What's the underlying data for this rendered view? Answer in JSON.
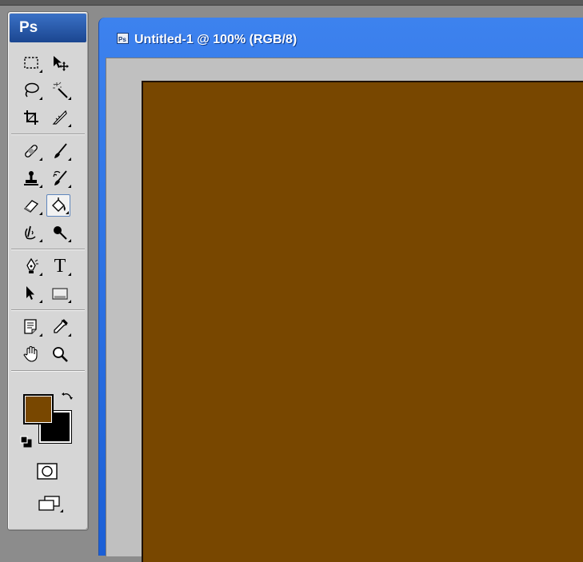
{
  "app": {
    "logo": "Ps"
  },
  "document": {
    "title": "Untitled-1 @ 100% (RGB/8)",
    "canvas_color": "#784700"
  },
  "colors": {
    "foreground": "#784700",
    "background": "#000000"
  },
  "tools": [
    {
      "name": "rectangular-marquee-icon",
      "selected": false
    },
    {
      "name": "move-tool-icon",
      "selected": false
    },
    {
      "name": "lasso-icon",
      "selected": false
    },
    {
      "name": "magic-wand-icon",
      "selected": false
    },
    {
      "name": "crop-icon",
      "selected": false
    },
    {
      "name": "slice-icon",
      "selected": false
    },
    {
      "name": "healing-brush-icon",
      "selected": false
    },
    {
      "name": "brush-icon",
      "selected": false
    },
    {
      "name": "clone-stamp-icon",
      "selected": false
    },
    {
      "name": "history-brush-icon",
      "selected": false
    },
    {
      "name": "eraser-icon",
      "selected": false
    },
    {
      "name": "paint-bucket-icon",
      "selected": true
    },
    {
      "name": "blur-icon",
      "selected": false
    },
    {
      "name": "dodge-icon",
      "selected": false
    },
    {
      "name": "pen-icon",
      "selected": false
    },
    {
      "name": "type-tool-icon",
      "selected": false,
      "label": "T"
    },
    {
      "name": "path-selection-icon",
      "selected": false
    },
    {
      "name": "rectangle-shape-icon",
      "selected": false
    },
    {
      "name": "notes-icon",
      "selected": false
    },
    {
      "name": "eyedropper-icon",
      "selected": false
    },
    {
      "name": "hand-icon",
      "selected": false
    },
    {
      "name": "zoom-icon",
      "selected": false
    }
  ]
}
